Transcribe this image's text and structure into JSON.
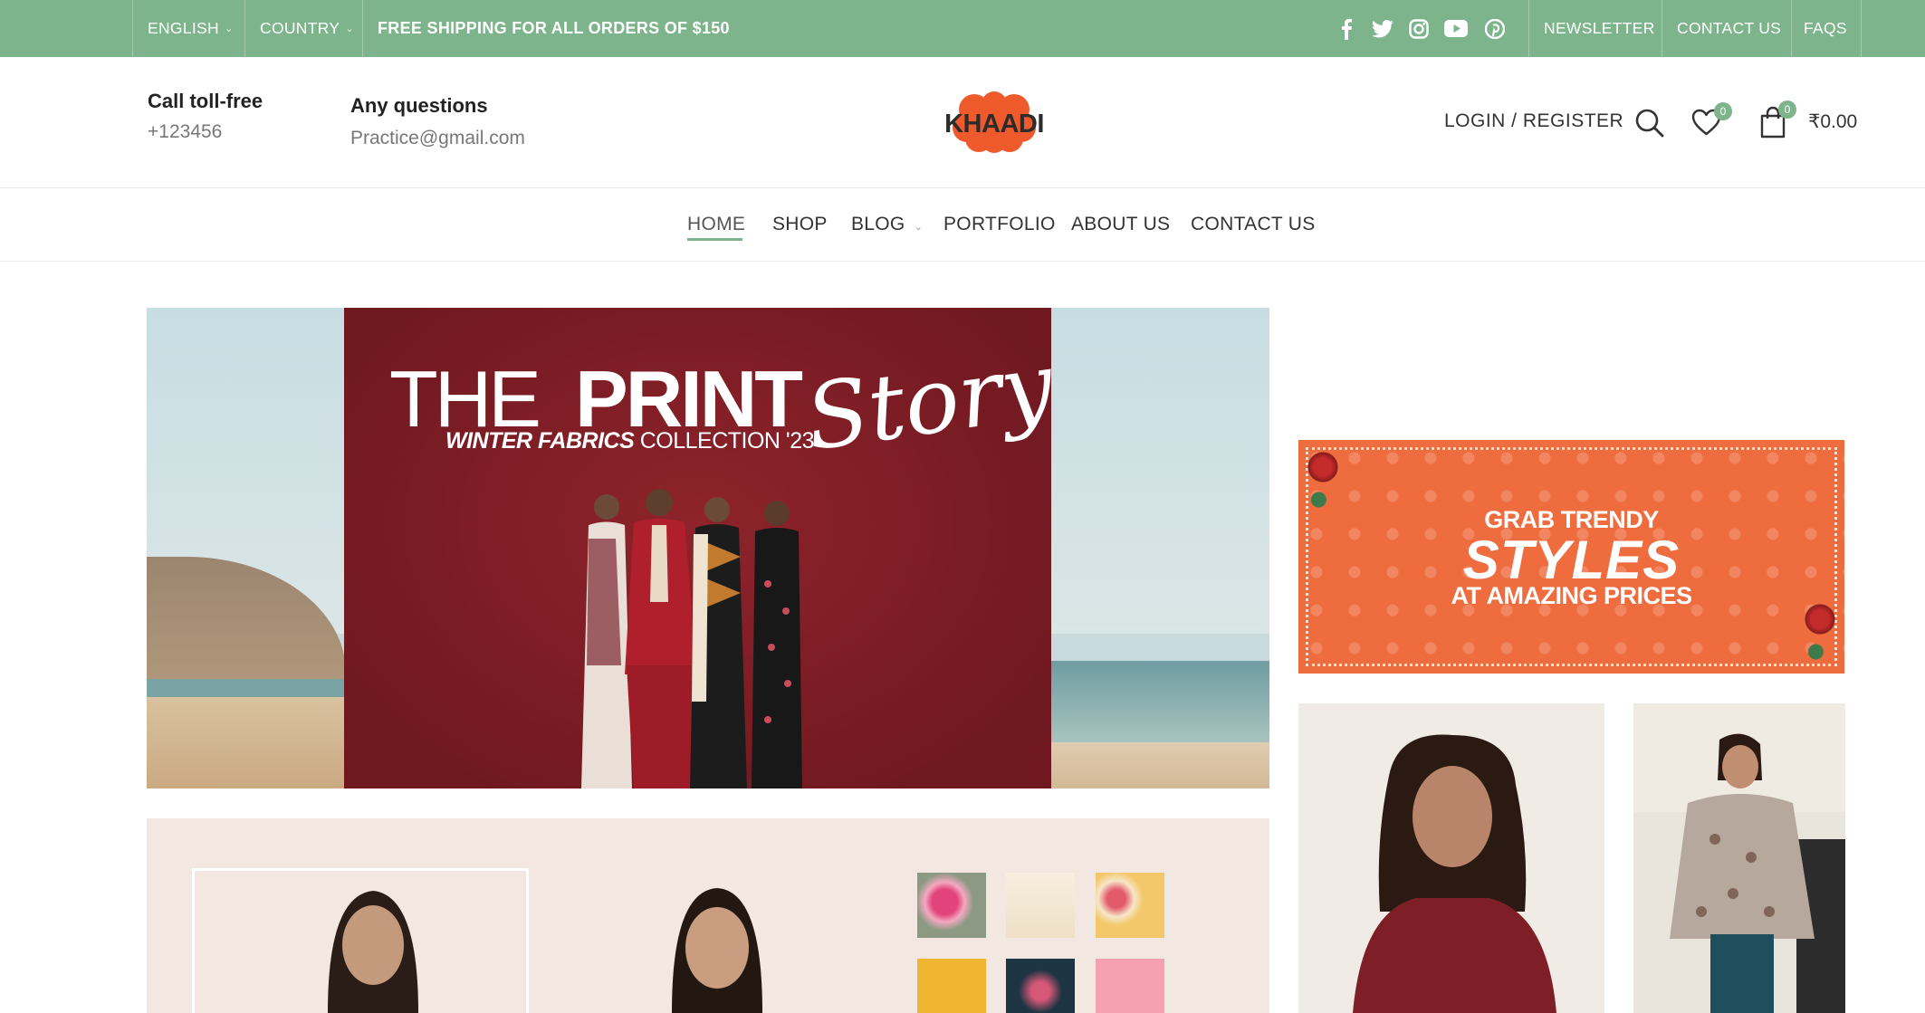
{
  "topbar": {
    "language": "ENGLISH",
    "country": "COUNTRY",
    "promo": "FREE SHIPPING FOR ALL ORDERS OF $150",
    "links": [
      "NEWSLETTER",
      "CONTACT US",
      "FAQS"
    ],
    "social_icons": [
      "facebook-icon",
      "twitter-icon",
      "instagram-icon",
      "youtube-icon",
      "pinterest-icon"
    ],
    "bg_color": "#7db48b"
  },
  "header": {
    "call_title": "Call toll-free",
    "call_number": "+123456",
    "questions_title": "Any questions",
    "email": "Practice@gmail.com",
    "logo_text": "KHAADI",
    "login": "LOGIN / REGISTER",
    "wishlist_count": "0",
    "cart_count": "0",
    "cart_total": "₹0.00"
  },
  "nav": {
    "items": [
      "HOME",
      "SHOP",
      "BLOG",
      "PORTFOLIO",
      "ABOUT US",
      "CONTACT US"
    ],
    "active": "HOME"
  },
  "hero": {
    "title_the": "THE",
    "title_print": "PRINT",
    "title_story": "Story",
    "subtitle_bold": "WINTER FABRICS",
    "subtitle_rest": "COLLECTION '23"
  },
  "promo": {
    "line1": "GRAB TRENDY",
    "line2": "STYLES",
    "line3": "AT AMAZING PRICES",
    "color": "#ef6c3e"
  }
}
